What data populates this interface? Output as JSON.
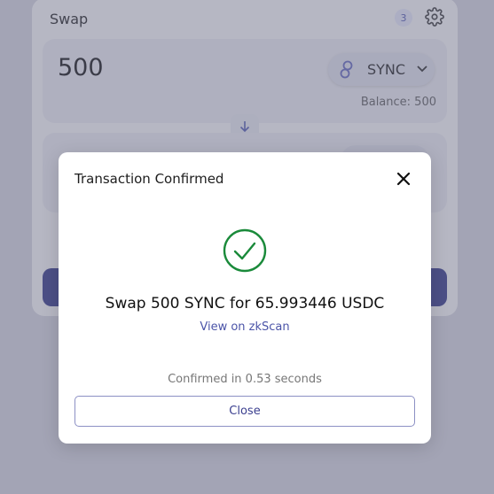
{
  "swap": {
    "title": "Swap",
    "notification_count": "3",
    "amount": "500",
    "token": "SYNC",
    "balance": "Balance: 500"
  },
  "modal": {
    "title": "Transaction Confirmed",
    "summary": "Swap 500 SYNC for 65.993446 USDC",
    "explorer_link": "View on zkScan",
    "confirmed_text": "Confirmed in 0.53 seconds",
    "close_label": "Close"
  },
  "colors": {
    "success": "#1a8a3a",
    "accent": "#3b3f8f",
    "link": "#4b54a8"
  },
  "icons": {
    "settings": "gear-icon",
    "token": "sync-token-icon",
    "chevron": "chevron-down-icon",
    "swap_arrow": "arrow-down-icon",
    "close": "close-icon",
    "success": "check-circle-icon"
  }
}
